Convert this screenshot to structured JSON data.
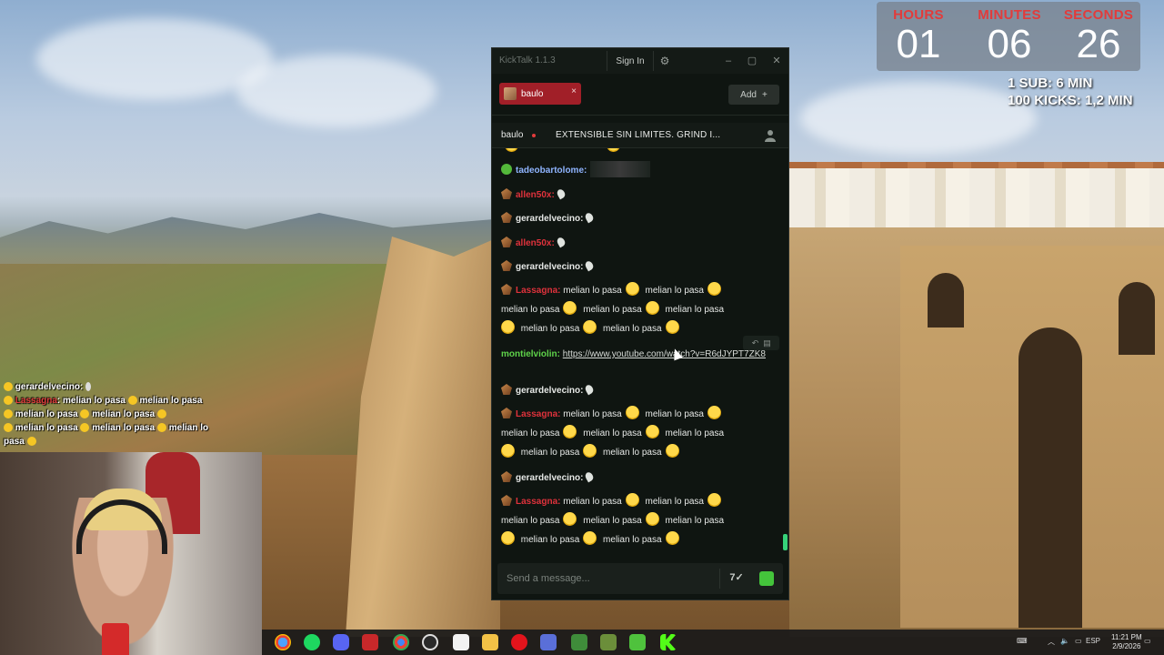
{
  "app": {
    "title": "KickTalk 1.1.3",
    "sign_in": "Sign In",
    "add_label": "Add",
    "add_plus": "+"
  },
  "tab": {
    "label": "baulo",
    "close": "×"
  },
  "stream": {
    "user": "baulo",
    "title": "EXTENSIBLE SIN LIMITES. GRIND I..."
  },
  "messages": [
    {
      "user": "tadeobartolome:",
      "color": "blue",
      "text": ""
    },
    {
      "user": "allen50x:",
      "color": "red",
      "text": ""
    },
    {
      "user": "gerardelvecino:",
      "color": "white",
      "text": ""
    },
    {
      "user": "allen50x:",
      "color": "red",
      "text": ""
    },
    {
      "user": "gerardelvecino:",
      "color": "white",
      "text": ""
    },
    {
      "user": "Lassagna:",
      "color": "red",
      "text": "melian lo pasa"
    },
    {
      "user": "montielviolin:",
      "color": "green",
      "link": "https://www.youtube.com/watch?v=R6dJYPT7ZK8"
    },
    {
      "user": "gerardelvecino:",
      "color": "white",
      "text": ""
    },
    {
      "user": "Lassagna:",
      "color": "red",
      "text": "melian lo pasa"
    },
    {
      "user": "gerardelvecino:",
      "color": "white",
      "text": ""
    },
    {
      "user": "Lassagna:",
      "color": "red",
      "text": "melian lo pasa"
    }
  ],
  "phrase": "melian lo pasa",
  "input": {
    "placeholder": "Send a message..."
  },
  "timer": {
    "hours_label": "HOURS",
    "minutes_label": "MINUTES",
    "seconds_label": "SECONDS",
    "hours": "01",
    "minutes": "06",
    "seconds": "26"
  },
  "sub_info": {
    "line1": "1 SUB: 6 MIN",
    "line2": "100 KICKS: 1,2 MIN"
  },
  "overlay_chat": {
    "user1": "gerardelvecino",
    "user2": "Lassagna",
    "phrase": "melian lo pasa"
  },
  "taskbar": {
    "lang": "ESP",
    "time": "11:21 PM",
    "date": "2/9/2026"
  },
  "colors": {
    "kick_green": "#53fc18",
    "tab_red": "#a11f28",
    "timer_label": "#e23b3b",
    "username_red": "#e0323c",
    "username_blue": "#8fb4ff",
    "username_green": "#5fd34a"
  }
}
